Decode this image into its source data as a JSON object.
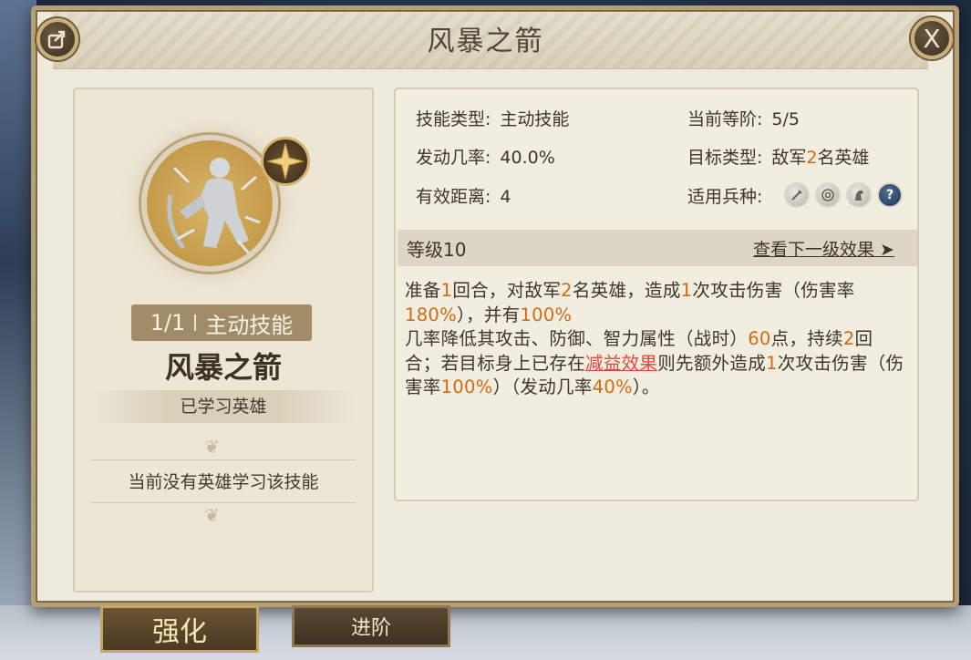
{
  "header": {
    "title": "风暴之箭",
    "close_label": "X"
  },
  "skill_card": {
    "count": "1/1",
    "type_tag": "主动技能",
    "name": "风暴之箭",
    "learned_title": "已学习英雄",
    "no_hero_text": "当前没有英雄学习该技能"
  },
  "attributes": {
    "skill_type_label": "技能类型:",
    "skill_type_value": "主动技能",
    "current_rank_label": "当前等阶:",
    "current_rank_value": "5/5",
    "trigger_rate_label": "发动几率:",
    "trigger_rate_value": "40.0%",
    "target_type_label": "目标类型:",
    "target_prefix": "敌军",
    "target_count": "2",
    "target_suffix": "名英雄",
    "range_label": "有效距离:",
    "range_value": "4",
    "troop_label": "适用兵种:",
    "troop_icons": [
      "sword-icon",
      "target-icon",
      "horse-icon",
      "question-icon"
    ],
    "troop_unknown_glyph": "?"
  },
  "level": {
    "label": "等级10",
    "next_link": "查看下一级效果 ➤"
  },
  "description": {
    "t1": "准备",
    "n1": "1",
    "t2": "回合，对敌军",
    "n2": "2",
    "t3": "名英雄，造成",
    "n3": "1",
    "t4": "次攻击伤害（伤害率",
    "n4": "180%",
    "t5": "），并有",
    "n5": "100%",
    "t6": "几率降低其攻击、防御、智力属性（战时）",
    "n6": "60",
    "t7": "点，持续",
    "n7": "2",
    "t8": "回合；若目标身上已存在",
    "link": "减益效果",
    "t9": "则先额外造成",
    "n8": "1",
    "t10": "次攻击伤害（伤害率",
    "n9": "100%",
    "t11": "）（发动几率",
    "n10": "40%",
    "t12": "）。"
  },
  "tabs": {
    "enhance": "强化",
    "advance": "进阶"
  },
  "colors": {
    "highlight": "#d26a12",
    "link": "#dd4a3a",
    "panel": "#efebdc",
    "border": "#b59f74"
  }
}
